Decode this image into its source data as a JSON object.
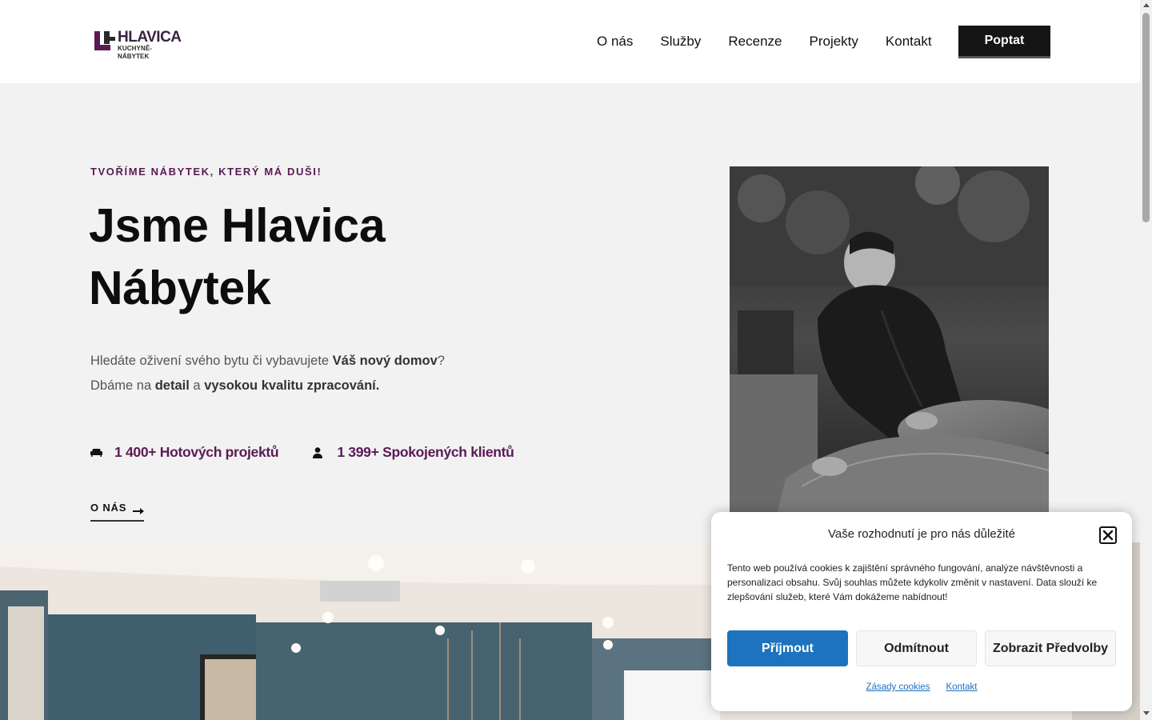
{
  "header": {
    "logo_name": "HLAVICA",
    "logo_sub": "KUCHYNĚ-NÁBYTEK",
    "nav": [
      "O nás",
      "Služby",
      "Recenze",
      "Projekty",
      "Kontakt"
    ],
    "cta_label": "Poptat"
  },
  "hero": {
    "eyebrow": "TVOŘÍME NÁBYTEK, KTERÝ MÁ DUŠI!",
    "title_line1": "Jsme Hlavica",
    "title_line2": "Nábytek",
    "text_1a": "Hledáte oživení svého bytu či vybavujete ",
    "text_1b": "Váš nový domov",
    "text_1c": "?",
    "text_2a": "Dbáme na ",
    "text_2b": "detail",
    "text_2c": " a ",
    "text_2d": "vysokou kvalitu zpracování.",
    "stat_1": "1 400+ Hotových projektů",
    "stat_2": "1 399+ Spokojených klientů",
    "about_link": "O NÁS"
  },
  "cookie": {
    "title": "Vaše rozhodnutí je pro nás důležité",
    "text": "Tento web používá cookies k zajištění správného fungování, analýze návštěvnosti a personalizaci obsahu. Svůj souhlas můžete kdykoliv změnit v nastavení. Data slouží ke zlepšování služeb, které Vám dokážeme nabídnout!",
    "accept": "Příjmout",
    "deny": "Odmítnout",
    "preferences": "Zobrazit Předvolby",
    "link_policy": "Zásady cookies",
    "link_contact": "Kontakt"
  },
  "colors": {
    "accent": "#5a1a55",
    "dark": "#151515",
    "accept_blue": "#1e73be"
  }
}
